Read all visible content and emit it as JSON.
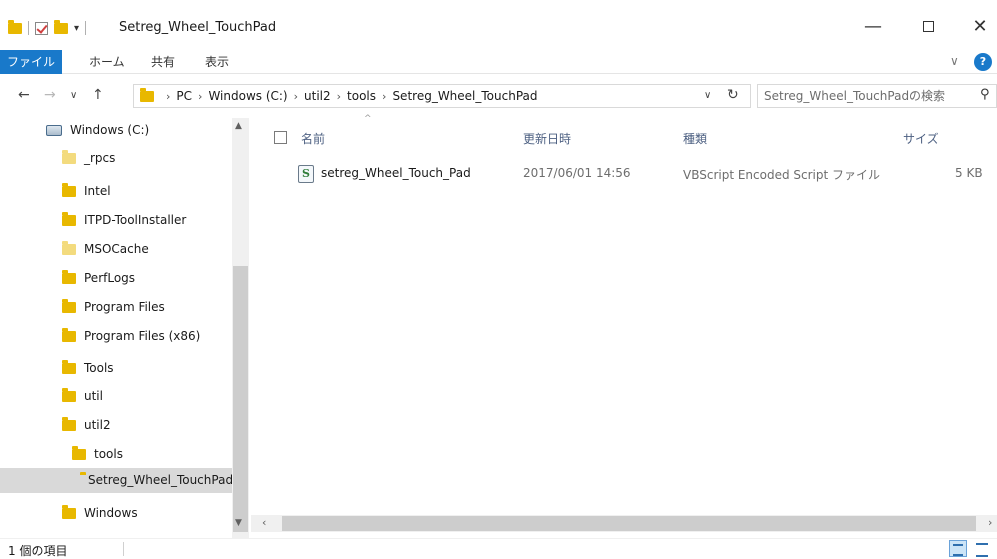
{
  "window": {
    "title": "Setreg_Wheel_TouchPad",
    "quick_access_dropdown": "▾",
    "minimize": "—",
    "close": "✕"
  },
  "ribbon": {
    "tabs": [
      "ファイル",
      "ホーム",
      "共有",
      "表示"
    ],
    "expand_chevron": "∨",
    "help": "?"
  },
  "address": {
    "back": "←",
    "forward": "→",
    "recent": "∨",
    "up": "↑",
    "breadcrumbs": [
      "PC",
      "Windows (C:)",
      "util2",
      "tools",
      "Setreg_Wheel_TouchPad"
    ],
    "separator": "›",
    "dropdown": "∨",
    "refresh": "↻",
    "search_placeholder": "Setreg_Wheel_TouchPadの検索",
    "search_icon": "⚲"
  },
  "nav_pane": {
    "items": [
      {
        "label": "Windows (C:)",
        "icon": "drive-icon"
      },
      {
        "label": "_rpcs",
        "icon": "folder-icon"
      },
      {
        "label": "Intel",
        "icon": "folder-icon"
      },
      {
        "label": "ITPD-ToolInstaller",
        "icon": "folder-icon"
      },
      {
        "label": "MSOCache",
        "icon": "folder-icon"
      },
      {
        "label": "PerfLogs",
        "icon": "folder-icon"
      },
      {
        "label": "Program Files",
        "icon": "folder-icon"
      },
      {
        "label": "Program Files (x86)",
        "icon": "folder-icon"
      },
      {
        "label": "Tools",
        "icon": "folder-icon"
      },
      {
        "label": "util",
        "icon": "folder-icon"
      },
      {
        "label": "util2",
        "icon": "folder-icon"
      },
      {
        "label": "tools",
        "icon": "folder-icon"
      },
      {
        "label": "Setreg_Wheel_TouchPad",
        "icon": "folder-icon",
        "selected": true
      },
      {
        "label": "Windows",
        "icon": "folder-icon"
      }
    ],
    "scroll_up": "▲",
    "scroll_down": "▼"
  },
  "file_list": {
    "columns": [
      "名前",
      "更新日時",
      "種類",
      "サイズ"
    ],
    "sort_caret": "^",
    "rows": [
      {
        "name": "setreg_Wheel_Touch_Pad",
        "modified": "2017/06/01 14:56",
        "type": "VBScript Encoded Script ファイル",
        "size": "5 KB",
        "icon": "vbscript-file-icon"
      }
    ]
  },
  "hscroll": {
    "left": "‹",
    "right": "›"
  },
  "status": {
    "item_count": "1 個の項目"
  },
  "colors": {
    "file_tab_bg": "#1979ca",
    "selected_bg": "#d9d9d9",
    "header_text": "#4d6082",
    "folder": "#e8b800"
  }
}
